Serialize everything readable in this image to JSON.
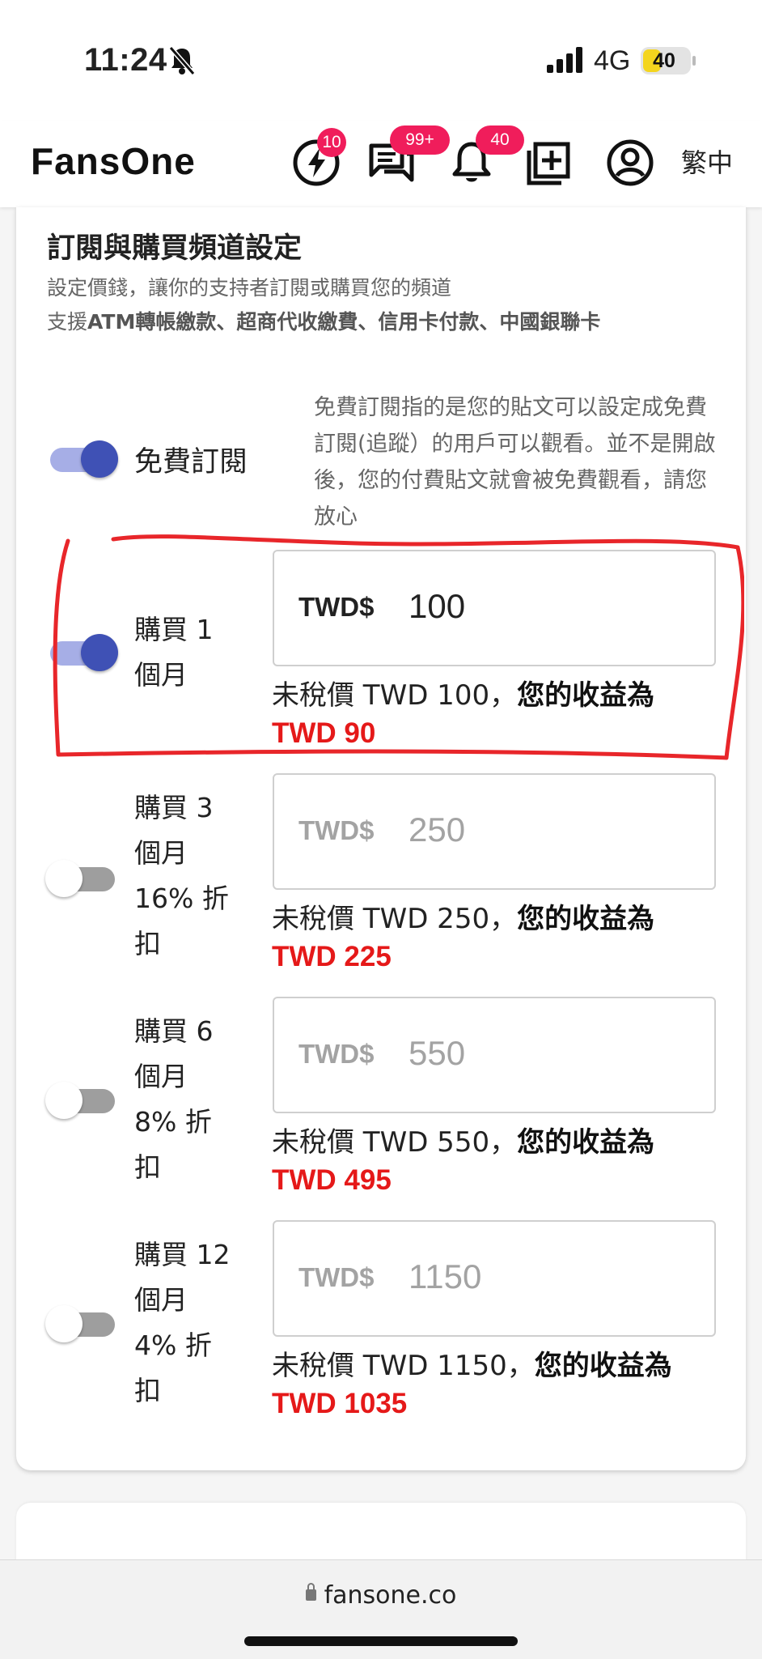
{
  "status_bar": {
    "time": "11:24",
    "network": "4G",
    "battery": "40",
    "battery_level": 0.4
  },
  "header": {
    "logo": "FansOne",
    "badges": {
      "flash": "10",
      "messages": "99+",
      "notifications": "40"
    },
    "language": "繁中"
  },
  "section": {
    "title": "訂閱與購買頻道設定",
    "desc1": "設定價錢，讓你的支持者訂閱或購買您的頻道",
    "desc2_prefix": "支援",
    "desc2_bold": "ATM轉帳繳款、超商代收繳費、信用卡付款、中國銀聯卡"
  },
  "free_sub": {
    "label": "免費訂閱",
    "enabled": true,
    "note": "免費訂閱指的是您的貼文可以設定成免費訂閱(追蹤）的用戶可以觀看。並不是開啟後，您的付費貼文就會被免費觀看，請您放心"
  },
  "plans": [
    {
      "line1": "購買 1",
      "line2": "個月",
      "enabled": true,
      "currency": "TWD$",
      "price": "100",
      "tax_label": "未稅價 TWD 100，",
      "earn_label": "您的收益為",
      "earn": "TWD 90"
    },
    {
      "line1": "購買 3",
      "line2": "個月",
      "line3": "16% 折",
      "line4": "扣",
      "enabled": false,
      "currency": "TWD$",
      "price": "250",
      "tax_label": "未稅價 TWD 250，",
      "earn_label": "您的收益為",
      "earn": "TWD 225"
    },
    {
      "line1": "購買 6",
      "line2": "個月",
      "line3": "8% 折",
      "line4": "扣",
      "enabled": false,
      "currency": "TWD$",
      "price": "550",
      "tax_label": "未稅價 TWD 550，",
      "earn_label": "您的收益為",
      "earn": "TWD 495"
    },
    {
      "line1": "購買 12",
      "line2": "個月",
      "line3": "4% 折",
      "line4": "扣",
      "enabled": false,
      "currency": "TWD$",
      "price": "1150",
      "tax_label": "未稅價 TWD 1150，",
      "earn_label": "您的收益為",
      "earn": "TWD 1035"
    }
  ],
  "browser": {
    "url": "fansone.co"
  },
  "colors": {
    "accent": "#3f51b5",
    "badge": "#f01d5b",
    "earn": "#e51919",
    "highlight": "#e8262a"
  }
}
